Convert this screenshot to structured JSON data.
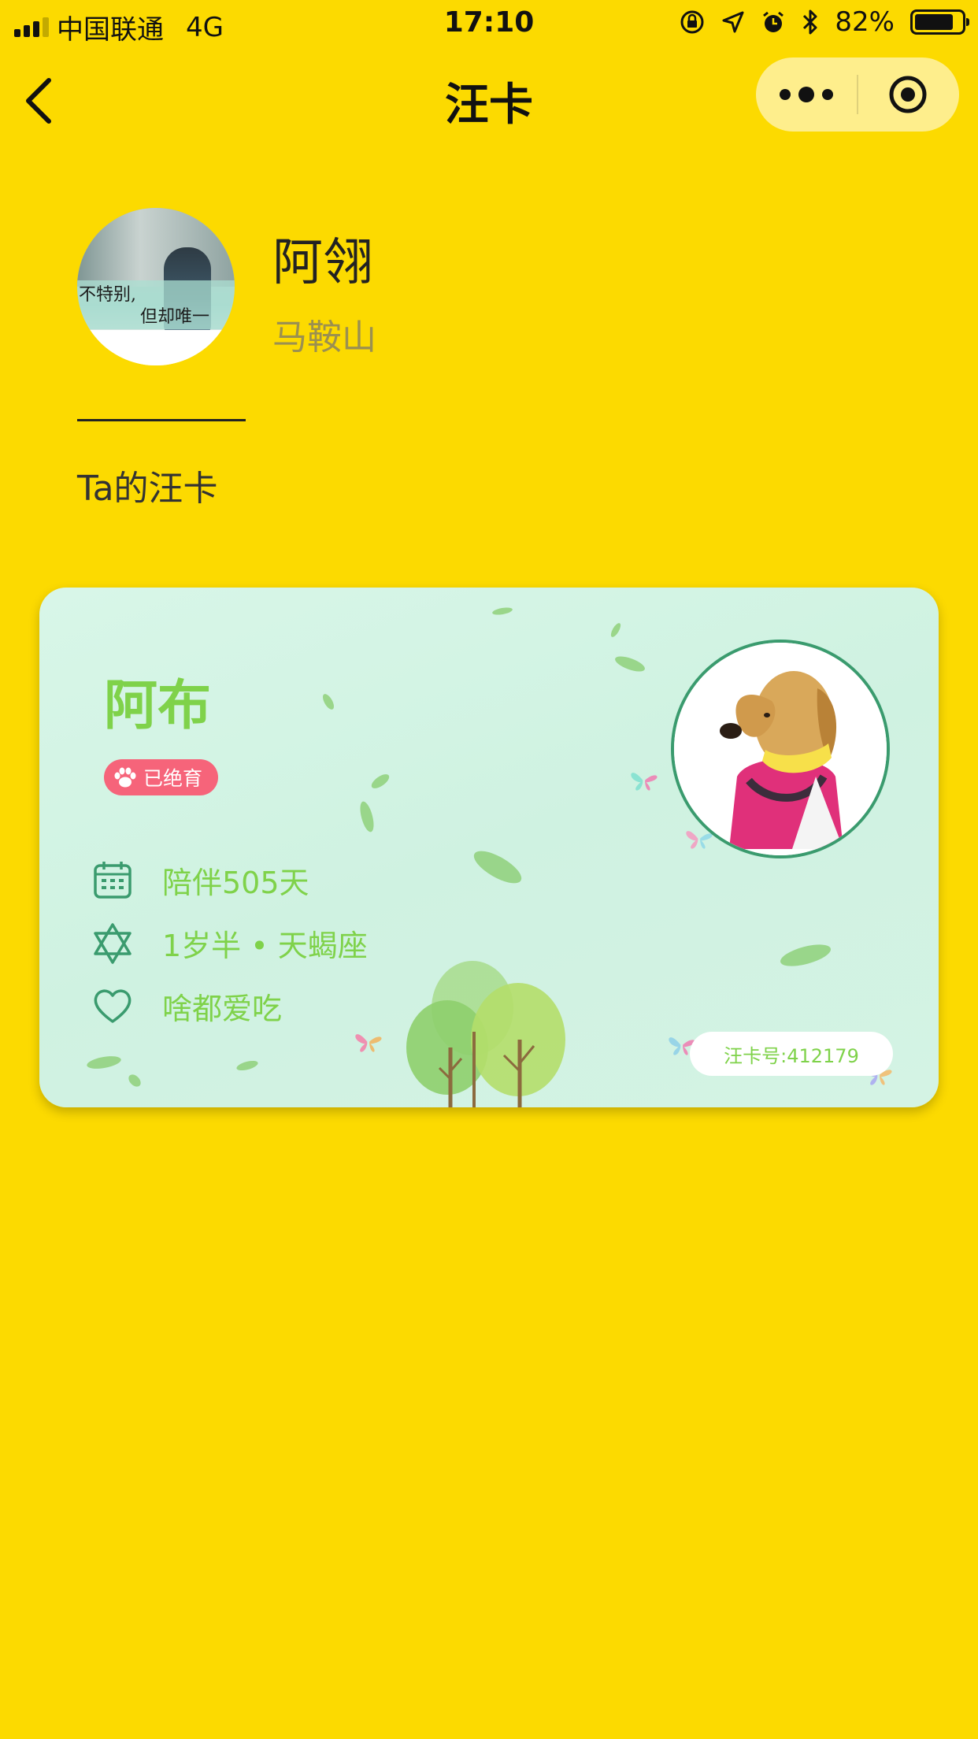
{
  "status_bar": {
    "carrier": "中国联通",
    "network": "4G",
    "time": "17:10",
    "battery_percent_text": "82%",
    "battery_level": 0.82,
    "signal_bars": 3
  },
  "nav": {
    "title": "汪卡",
    "back_icon": "chevron-left-icon",
    "more_icon": "more-dots-icon",
    "close_icon": "target-circle-icon"
  },
  "profile": {
    "name": "阿翎",
    "location": "马鞍山",
    "avatar_text_line1": "不特别,",
    "avatar_text_line2": "但却唯一"
  },
  "section": {
    "title": "Ta的汪卡"
  },
  "card": {
    "pet_name": "阿布",
    "badge": "已绝育",
    "info": [
      {
        "icon": "calendar-icon",
        "text": "陪伴505天"
      },
      {
        "icon": "star-of-david-icon",
        "text": "1岁半 • 天蝎座"
      },
      {
        "icon": "heart-icon",
        "text": "啥都爱吃"
      }
    ],
    "card_number": "汪卡号:412179"
  },
  "colors": {
    "background": "#FCDA00",
    "card_bg": "#D5F4E5",
    "accent_green": "#7FD24A",
    "icon_green": "#3A9B6E",
    "badge_pink": "#F6647A"
  }
}
